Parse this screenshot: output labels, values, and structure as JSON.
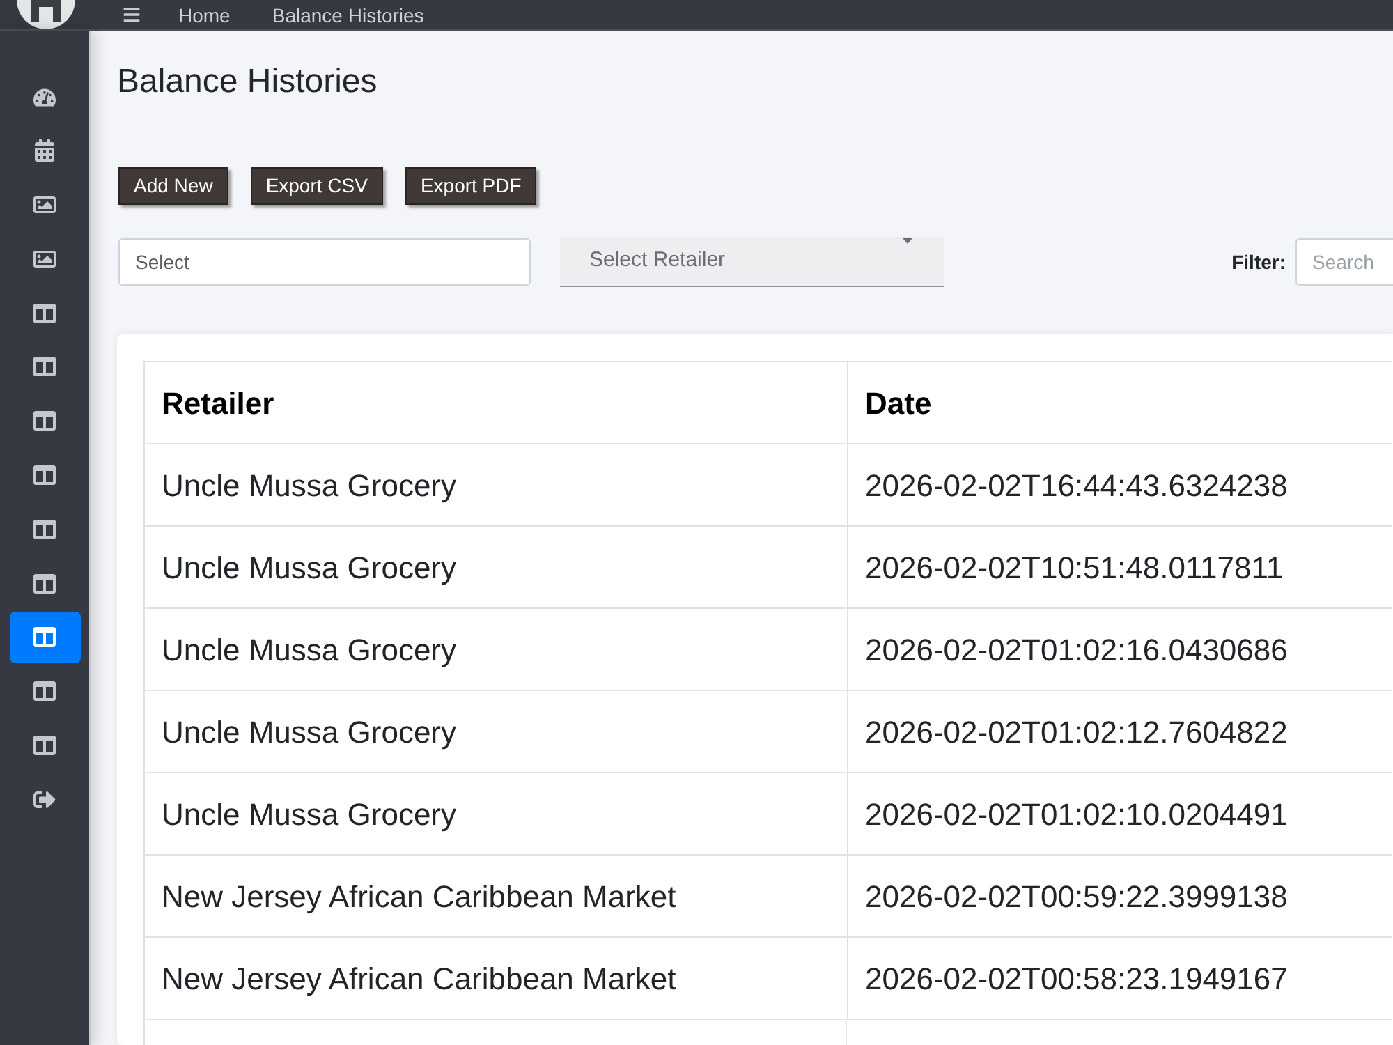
{
  "topbar": {
    "breadcrumbs": [
      "Home",
      "Balance Histories"
    ]
  },
  "sidebar": {
    "items": [
      {
        "kind": "gauge",
        "selected": false
      },
      {
        "kind": "calendar",
        "selected": false
      },
      {
        "kind": "image",
        "selected": false
      },
      {
        "kind": "image",
        "selected": false
      },
      {
        "kind": "table",
        "selected": false
      },
      {
        "kind": "table",
        "selected": false
      },
      {
        "kind": "table",
        "selected": false
      },
      {
        "kind": "table",
        "selected": false
      },
      {
        "kind": "table",
        "selected": false
      },
      {
        "kind": "table",
        "selected": false
      },
      {
        "kind": "table",
        "selected": true
      },
      {
        "kind": "table",
        "selected": false
      },
      {
        "kind": "table",
        "selected": false
      },
      {
        "kind": "logout",
        "selected": false
      }
    ]
  },
  "page": {
    "title": "Balance Histories"
  },
  "actions": [
    "Add New",
    "Export CSV",
    "Export PDF"
  ],
  "filters": {
    "select": {
      "placeholder": "Select"
    },
    "retailer": {
      "placeholder": "Select Retailer"
    },
    "filter_label": "Filter:",
    "search": {
      "placeholder": "Search"
    }
  },
  "table": {
    "columns": [
      "Retailer",
      "Date"
    ],
    "rows": [
      [
        "Uncle Mussa Grocery",
        "2026-02-02T16:44:43.6324238"
      ],
      [
        "Uncle Mussa Grocery",
        "2026-02-02T10:51:48.0117811"
      ],
      [
        "Uncle Mussa Grocery",
        "2026-02-02T01:02:16.0430686"
      ],
      [
        "Uncle Mussa Grocery",
        "2026-02-02T01:02:12.7604822"
      ],
      [
        "Uncle Mussa Grocery",
        "2026-02-02T01:02:10.0204491"
      ],
      [
        "New Jersey African Caribbean Market",
        "2026-02-02T00:59:22.3999138"
      ],
      [
        "New Jersey African Caribbean Market",
        "2026-02-02T00:58:23.1949167"
      ]
    ]
  }
}
